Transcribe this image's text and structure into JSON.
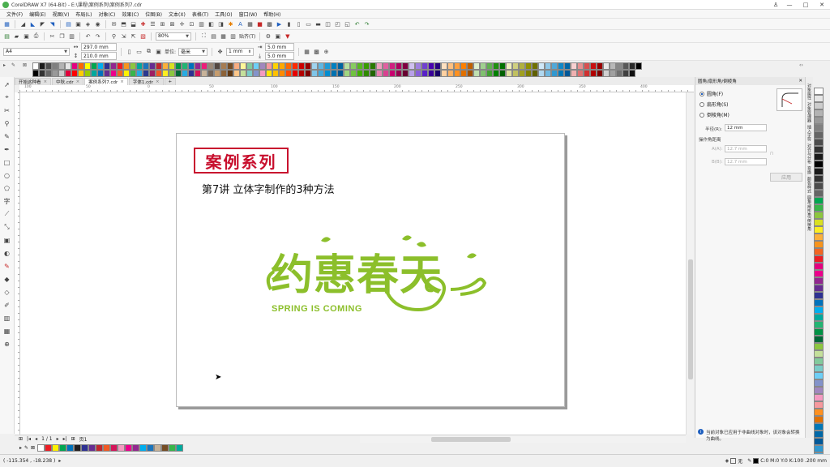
{
  "window": {
    "title": "CorelDRAW X7 (64-Bit) - E:\\课程\\案例系列\\案例系列7.cdr",
    "minimize": "—",
    "maximize": "□",
    "close": "✕"
  },
  "menu": [
    "文件(F)",
    "编辑(E)",
    "视图(V)",
    "布局(L)",
    "对象(C)",
    "效果(C)",
    "位图(B)",
    "文本(X)",
    "表格(T)",
    "工具(O)",
    "窗口(W)",
    "帮助(H)"
  ],
  "toolbar": {
    "zoom_level": "80%",
    "snap_label": "贴齐(T)",
    "page_size": "A4",
    "width": "297.0 mm",
    "height": "210.0 mm",
    "units_label": "单位:",
    "units": "毫米",
    "nudge": "1 mm",
    "dup_x": "5.0 mm",
    "dup_y": "5.0 mm"
  },
  "doc_tabs": [
    "开始这种看",
    "中秋.cdr",
    "案例系列7.cdr",
    "字体1.cdr"
  ],
  "active_tab_index": 2,
  "canvas": {
    "case_title": "案例系列",
    "lesson_title": "第7讲 立体字制作的3种方法",
    "art_text": "约惠春天",
    "art_subtitle": "SPRING IS COMING"
  },
  "ruler_h_labels": [
    "100",
    "50",
    "0",
    "50",
    "100",
    "150",
    "200",
    "250",
    "300",
    "350",
    "400"
  ],
  "docker": {
    "title": "圆角/扇形角/倒棱角",
    "options": [
      "圆角(F)",
      "扇形角(S)",
      "倒棱角(M)"
    ],
    "radius_label": "半径(R):",
    "radius_value": "12 mm",
    "distance_label": "操作角距离",
    "a_label": "A(A):",
    "a_value": "12.7 mm",
    "b_label": "B(B):",
    "b_value": "12.7 mm",
    "apply_label": "应用",
    "info": "当前对象已应用于非曲线对象时，该对象会转换为曲线。"
  },
  "docker_tabs": [
    "对象属性",
    "对象管理器",
    "插入字符",
    "对齐与分布",
    "变换",
    "颜色样式",
    "圆角/扇形角/倒棱角"
  ],
  "page_nav": {
    "counter": "1 / 1",
    "page_tab": "页1"
  },
  "status": {
    "coords": "( -115.354 , -18.238 )",
    "fill_label": "无",
    "outline": "C:0 M:0 Y:0 K:100  .200 mm"
  },
  "colors": {
    "accent_red": "#c8102e",
    "spring_green": "#8cbf2b",
    "palette_top": [
      "#ffffff",
      "#000000",
      "#1a1a1a",
      "#333333",
      "#4d4d4d",
      "#666666",
      "#808080",
      "#999999",
      "#b3b3b3",
      "#cccccc",
      "#e6e6e6",
      "#e0003c",
      "#e4007f",
      "#ff0000",
      "#ff6600",
      "#ffcc00",
      "#ffff00",
      "#99cc00",
      "#00a651",
      "#00a99d",
      "#00aeef",
      "#0072bc",
      "#2e3192",
      "#662d91",
      "#92278f",
      "#ec008c",
      "#ed1c24",
      "#f26522",
      "#f7941d",
      "#fff200",
      "#8dc63f",
      "#39b54a",
      "#00a79d",
      "#27aae1",
      "#1c75bc",
      "#2b3990",
      "#662d91",
      "#9e1f63",
      "#c1272d",
      "#f15a24",
      "#fbb03b",
      "#fcee21",
      "#d9e021",
      "#8cc63f",
      "#009245",
      "#006837",
      "#22b573",
      "#29abe2",
      "#0071bc",
      "#2e3192",
      "#93278f",
      "#d4145a",
      "#ed1e79",
      "#c7b299",
      "#998675",
      "#736357",
      "#534741",
      "#c69c6d",
      "#a67c52",
      "#8c6239",
      "#754c24",
      "#603813",
      "#f9ad81",
      "#fdc689",
      "#fff799",
      "#c4df9b",
      "#82ca9c",
      "#7accc8",
      "#6dcff6",
      "#8393ca",
      "#a187be",
      "#f49ac1",
      "#f6989d",
      "#ffe600",
      "#ffd200",
      "#ffc000",
      "#ffa800",
      "#ff8a00",
      "#ff6a00",
      "#ff4a00",
      "#ff2a00",
      "#e60000",
      "#cc0000",
      "#b30000",
      "#990000",
      "#800000",
      "#9fd3ee",
      "#7fc5e8",
      "#5fb7e2",
      "#3fa9dc",
      "#1f9bd6",
      "#008dd0",
      "#0080c0",
      "#0072b0",
      "#0064a0",
      "#005690",
      "#b8e0a0",
      "#a0d680",
      "#88cc60",
      "#70c240",
      "#58b820",
      "#40ae00",
      "#389c00",
      "#308a00",
      "#287800",
      "#206600",
      "#f0a0c0",
      "#e880b0",
      "#e060a0",
      "#d84090",
      "#d02080",
      "#c80070",
      "#b00060",
      "#980050",
      "#800040",
      "#680030",
      "#d0c0f0",
      "#b8a0e8",
      "#a080e0",
      "#8860d8",
      "#7040d0",
      "#5820c8",
      "#4800b0",
      "#380098",
      "#280080",
      "#180068",
      "#ffe0c0",
      "#ffd0a0",
      "#ffc080",
      "#ffb060",
      "#ffa040",
      "#ff9020",
      "#ff8000",
      "#e07000",
      "#c06000",
      "#a05000",
      "#e0f0d0",
      "#c0e0b0",
      "#a0d090",
      "#80c070",
      "#60b050",
      "#40a030",
      "#209010",
      "#008000",
      "#007000",
      "#006000",
      "#f0f0c0",
      "#e0e0a0",
      "#d0d080",
      "#c0c060",
      "#b0b040",
      "#a0a020",
      "#909000",
      "#808000",
      "#707000",
      "#606000",
      "#d0e8f8",
      "#b0d8f0",
      "#90c8e8",
      "#70b8e0",
      "#50a8d8",
      "#3098d0",
      "#1088c8",
      "#0078b8",
      "#0068a8",
      "#005898",
      "#f8d0d0",
      "#f0b0b0",
      "#e89090",
      "#e07070",
      "#d85050",
      "#d03030",
      "#c81010",
      "#b00000",
      "#980000",
      "#800000",
      "#e8e8e8",
      "#d0d0d0",
      "#b8b8b8",
      "#a0a0a0",
      "#888888",
      "#707070",
      "#585858",
      "#404040",
      "#282828",
      "#101010",
      "#000000"
    ],
    "palette_right": [
      "#ffffff",
      "#e6e6e6",
      "#cccccc",
      "#b3b3b3",
      "#999999",
      "#808080",
      "#666666",
      "#4d4d4d",
      "#333333",
      "#1a1a1a",
      "#000000",
      "#1a1a1a",
      "#333333",
      "#4d4d4d",
      "#666666",
      "#00a651",
      "#39b54a",
      "#8dc63f",
      "#d9e021",
      "#fcee21",
      "#fbb03b",
      "#f7941d",
      "#f26522",
      "#ed1c24",
      "#e4007f",
      "#ec008c",
      "#92278f",
      "#662d91",
      "#2e3192",
      "#0072bc",
      "#00aeef",
      "#00a99d",
      "#22b573",
      "#009245",
      "#006837",
      "#8cc63f",
      "#c4df9b",
      "#82ca9c",
      "#7accc8",
      "#6dcff6",
      "#8393ca",
      "#a187be",
      "#f49ac1",
      "#f6989d",
      "#ff9020",
      "#e07000",
      "#0078b8",
      "#0068a8",
      "#005898",
      "#3098d0",
      "#50a8d8"
    ],
    "doc_palette": [
      "#ffffff",
      "#ed1c24",
      "#fff200",
      "#00a651",
      "#0072bc",
      "#231f20",
      "#2e3192",
      "#662d91",
      "#c1272d",
      "#f15a24",
      "#d4145a",
      "#f49ac1",
      "#ec008c",
      "#92278f",
      "#00aeef",
      "#1c75bc",
      "#c7b299",
      "#754c24",
      "#39b54a",
      "#00a99d"
    ]
  }
}
